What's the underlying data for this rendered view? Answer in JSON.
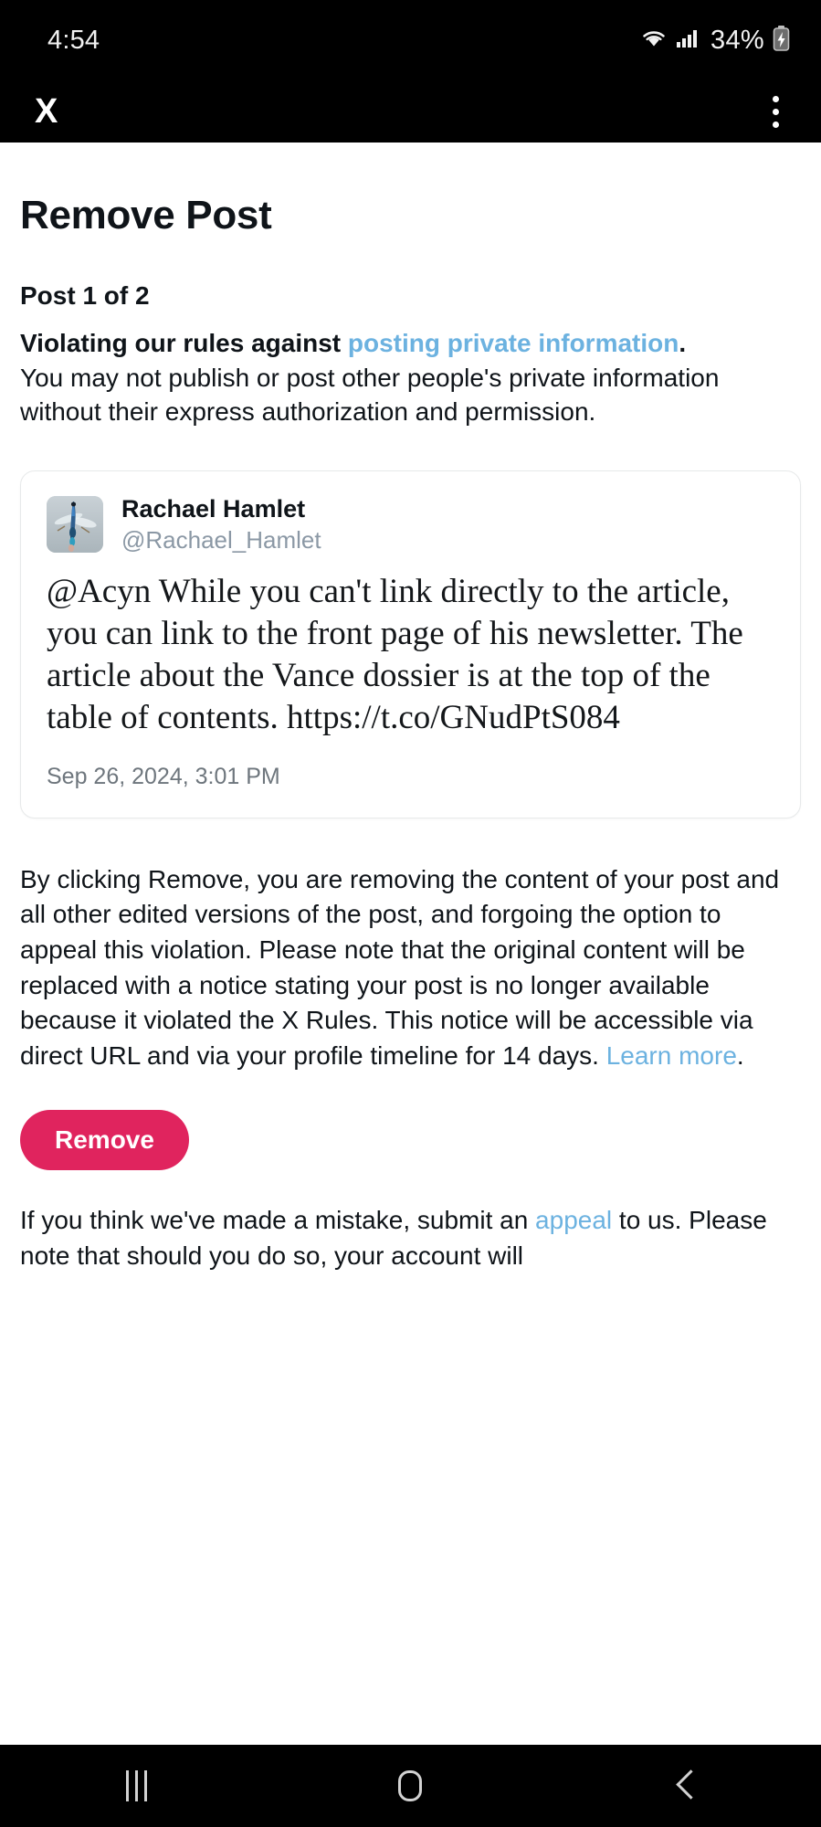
{
  "status_bar": {
    "time": "4:54",
    "battery_percent": "34%",
    "wifi_icon": "wifi-icon",
    "signal_icon": "cellular-signal-icon",
    "battery_icon": "battery-charging-icon"
  },
  "app_bar": {
    "logo": "X",
    "logo_icon": "x-logo-icon",
    "overflow_icon": "kebab-menu-icon"
  },
  "page": {
    "title": "Remove Post",
    "post_counter": "Post 1 of 2",
    "violation_headline_prefix": "Violating our rules against ",
    "violation_link": "posting private information",
    "violation_headline_suffix": ".",
    "violation_body": "You may not publish or post other people's private information without their express authorization and permission."
  },
  "post_card": {
    "author_name": "Rachael Hamlet",
    "author_handle": "@Rachael_Hamlet",
    "avatar_icon": "dragonfly-avatar-image",
    "text": "@Acyn While you can't link directly to the article, you can link to the front page of his newsletter. The article about the Vance dossier is at the top of the table of contents. https://t.co/GNudPtS084",
    "date": "Sep 26, 2024, 3:01 PM"
  },
  "disclaimer": {
    "body": "By clicking Remove, you are removing the content of your post and all other edited versions of the post, and forgoing the option to appeal this violation. Please note that the original content will be replaced with a notice stating your post is no longer available because it violated the X Rules. This notice will be accessible via direct URL and via your profile timeline for 14 days. ",
    "learn_more": "Learn more",
    "learn_more_suffix": "."
  },
  "actions": {
    "remove_label": "Remove",
    "remove_color": "#e0245e"
  },
  "appeal": {
    "prefix": "If you think we've made a mistake, submit an ",
    "link": "appeal",
    "suffix": " to us. Please note that should you do so, your account will"
  },
  "nav_bar": {
    "recents_icon": "recents-icon",
    "home_icon": "home-icon",
    "back_icon": "back-icon"
  },
  "colors": {
    "link": "#6cb2e0",
    "text": "#0f1419",
    "muted": "#8b98a5",
    "accent": "#e0245e"
  }
}
